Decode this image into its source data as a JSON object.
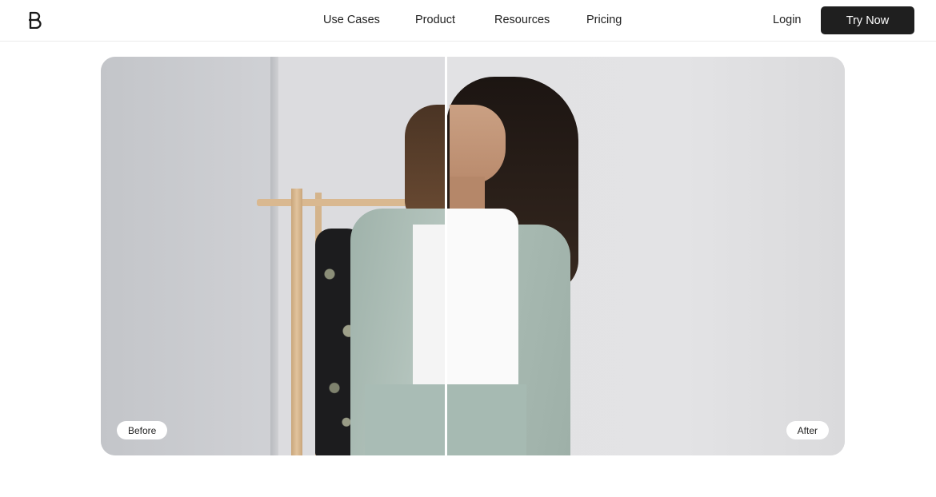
{
  "nav": {
    "logo_icon": "brand-logo-icon",
    "links": [
      "Use Cases",
      "Product",
      "Resources",
      "Pricing"
    ],
    "login_label": "Login",
    "cta_label": "Try Now"
  },
  "comparison": {
    "before_label": "Before",
    "after_label": "After",
    "divider_position": 0.464
  },
  "colors": {
    "cta_background": "#1f1f1f",
    "cta_text": "#ffffff"
  }
}
